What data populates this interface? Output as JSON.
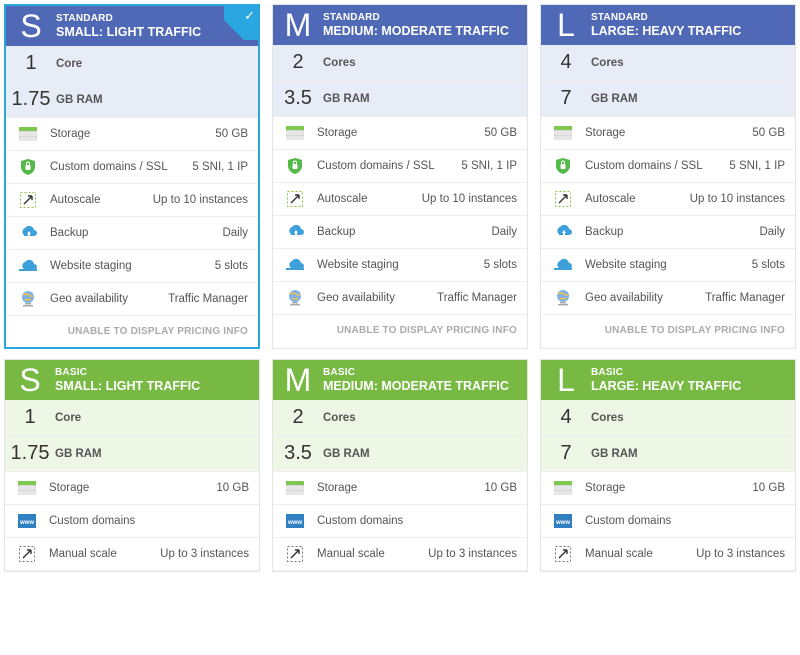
{
  "footer_text": "UNABLE TO DISPLAY PRICING INFO",
  "tiles": [
    {
      "id": "std-s",
      "tier_key": "standard",
      "selected": true,
      "letter": "S",
      "tier": "STANDARD",
      "name": "SMALL: LIGHT TRAFFIC",
      "specs": [
        {
          "num": "1",
          "lbl": "Core"
        },
        {
          "num": "1.75",
          "lbl": "GB RAM"
        }
      ],
      "feats": [
        {
          "icon": "storage-icon",
          "label": "Storage",
          "value": "50 GB"
        },
        {
          "icon": "ssl-icon",
          "label": "Custom domains / SSL",
          "value": "5 SNI, 1 IP"
        },
        {
          "icon": "autoscale-icon",
          "label": "Autoscale",
          "value": "Up to 10 instances"
        },
        {
          "icon": "backup-icon",
          "label": "Backup",
          "value": "Daily"
        },
        {
          "icon": "staging-icon",
          "label": "Website staging",
          "value": "5 slots"
        },
        {
          "icon": "geo-icon",
          "label": "Geo availability",
          "value": "Traffic Manager"
        }
      ],
      "has_footer": true
    },
    {
      "id": "std-m",
      "tier_key": "standard",
      "selected": false,
      "letter": "M",
      "tier": "STANDARD",
      "name": "MEDIUM: MODERATE TRAFFIC",
      "specs": [
        {
          "num": "2",
          "lbl": "Cores"
        },
        {
          "num": "3.5",
          "lbl": "GB RAM"
        }
      ],
      "feats": [
        {
          "icon": "storage-icon",
          "label": "Storage",
          "value": "50 GB"
        },
        {
          "icon": "ssl-icon",
          "label": "Custom domains / SSL",
          "value": "5 SNI, 1 IP"
        },
        {
          "icon": "autoscale-icon",
          "label": "Autoscale",
          "value": "Up to 10 instances"
        },
        {
          "icon": "backup-icon",
          "label": "Backup",
          "value": "Daily"
        },
        {
          "icon": "staging-icon",
          "label": "Website staging",
          "value": "5 slots"
        },
        {
          "icon": "geo-icon",
          "label": "Geo availability",
          "value": "Traffic Manager"
        }
      ],
      "has_footer": true
    },
    {
      "id": "std-l",
      "tier_key": "standard",
      "selected": false,
      "letter": "L",
      "tier": "STANDARD",
      "name": "LARGE: HEAVY TRAFFIC",
      "specs": [
        {
          "num": "4",
          "lbl": "Cores"
        },
        {
          "num": "7",
          "lbl": "GB RAM"
        }
      ],
      "feats": [
        {
          "icon": "storage-icon",
          "label": "Storage",
          "value": "50 GB"
        },
        {
          "icon": "ssl-icon",
          "label": "Custom domains / SSL",
          "value": "5 SNI, 1 IP"
        },
        {
          "icon": "autoscale-icon",
          "label": "Autoscale",
          "value": "Up to 10 instances"
        },
        {
          "icon": "backup-icon",
          "label": "Backup",
          "value": "Daily"
        },
        {
          "icon": "staging-icon",
          "label": "Website staging",
          "value": "5 slots"
        },
        {
          "icon": "geo-icon",
          "label": "Geo availability",
          "value": "Traffic Manager"
        }
      ],
      "has_footer": true
    },
    {
      "id": "bas-s",
      "tier_key": "basic",
      "selected": false,
      "letter": "S",
      "tier": "BASIC",
      "name": "SMALL: LIGHT TRAFFIC",
      "specs": [
        {
          "num": "1",
          "lbl": "Core"
        },
        {
          "num": "1.75",
          "lbl": "GB RAM"
        }
      ],
      "feats": [
        {
          "icon": "storage-icon",
          "label": "Storage",
          "value": "10 GB"
        },
        {
          "icon": "domains-icon",
          "label": "Custom domains",
          "value": ""
        },
        {
          "icon": "manual-icon",
          "label": "Manual scale",
          "value": "Up to 3 instances"
        }
      ],
      "has_footer": false
    },
    {
      "id": "bas-m",
      "tier_key": "basic",
      "selected": false,
      "letter": "M",
      "tier": "BASIC",
      "name": "MEDIUM: MODERATE TRAFFIC",
      "specs": [
        {
          "num": "2",
          "lbl": "Cores"
        },
        {
          "num": "3.5",
          "lbl": "GB RAM"
        }
      ],
      "feats": [
        {
          "icon": "storage-icon",
          "label": "Storage",
          "value": "10 GB"
        },
        {
          "icon": "domains-icon",
          "label": "Custom domains",
          "value": ""
        },
        {
          "icon": "manual-icon",
          "label": "Manual scale",
          "value": "Up to 3 instances"
        }
      ],
      "has_footer": false
    },
    {
      "id": "bas-l",
      "tier_key": "basic",
      "selected": false,
      "letter": "L",
      "tier": "BASIC",
      "name": "LARGE: HEAVY TRAFFIC",
      "specs": [
        {
          "num": "4",
          "lbl": "Cores"
        },
        {
          "num": "7",
          "lbl": "GB RAM"
        }
      ],
      "feats": [
        {
          "icon": "storage-icon",
          "label": "Storage",
          "value": "10 GB"
        },
        {
          "icon": "domains-icon",
          "label": "Custom domains",
          "value": ""
        },
        {
          "icon": "manual-icon",
          "label": "Manual scale",
          "value": "Up to 3 instances"
        }
      ],
      "has_footer": false
    }
  ]
}
